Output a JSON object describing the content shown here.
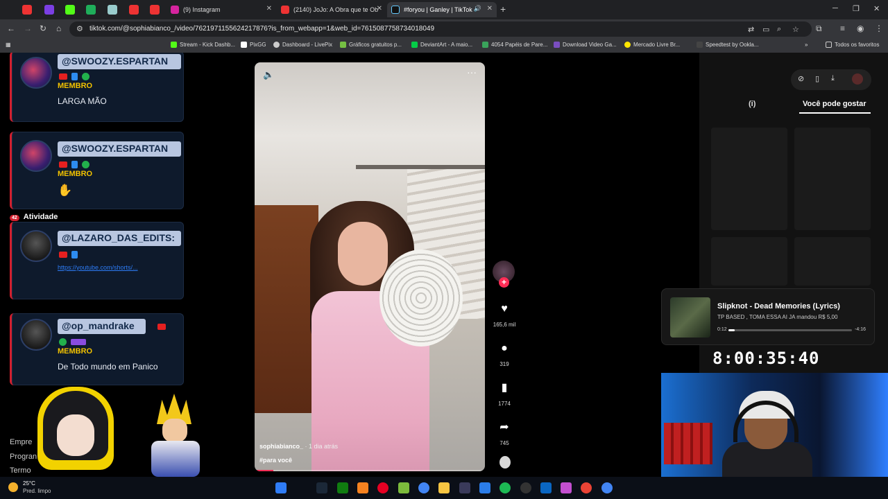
{
  "browser": {
    "tabs": [
      {
        "title": "(9) Instagram",
        "active": false
      },
      {
        "title": "(2140) JoJo: A Obra que te Ob",
        "active": false
      },
      {
        "title": "#foryou | Ganley | TikTok",
        "active": true
      }
    ],
    "new_tab_label": "+",
    "url": "tiktok.com/@sophiabianco_/video/7621971155624217876?is_from_webapp=1&web_id=7615087758734018049",
    "bookmarks": [
      {
        "label": "Stream - Kick Dashb...",
        "color": "#53fc18"
      },
      {
        "label": "PixGG",
        "color": "#ffffff"
      },
      {
        "label": "Dashboard - LivePix",
        "color": "#cccccc"
      },
      {
        "label": "Gráficos gratuitos p...",
        "color": "#76c043"
      },
      {
        "label": "DeviantArt - A maio...",
        "color": "#05cc47"
      },
      {
        "label": "4054 Papéis de Pare...",
        "color": "#3aa35b"
      },
      {
        "label": "Download Video Ga...",
        "color": "#7a4ec0"
      },
      {
        "label": "Mercado Livre Br...",
        "color": "#ffe600"
      },
      {
        "label": "Speedtest by Ookla...",
        "color": "#1e1e1e"
      }
    ],
    "all_bookmarks_label": "Todos os favoritos"
  },
  "chat": {
    "messages": [
      {
        "name": "@SWOOZY.ESPARTAN",
        "role": "MEMBRO",
        "text": "LARGA MÃO"
      },
      {
        "name": "@SWOOZY.ESPARTAN",
        "role": "MEMBRO",
        "text": "✋"
      },
      {
        "name": "@LAZARO_DAS_EDITS:",
        "link": "https://youtube.com/shorts/..."
      },
      {
        "name": "@op_mandrake",
        "role": "MEMBRO",
        "text": "De Todo mundo em Panico"
      }
    ],
    "activity_label": "Atividade",
    "activity_count": "42",
    "left_partial": [
      "Empre",
      "Progran",
      "Termo"
    ]
  },
  "video": {
    "author": "sophiabianco_",
    "time_ago": " · 1 dia atrás",
    "tag": "#para você",
    "progress": 0.08,
    "mute_icon": "🔈",
    "more_icon": "···"
  },
  "actions": {
    "likes": "165,6 mil",
    "comments": "319",
    "saves": "1774",
    "shares": "745",
    "follow_icon": "+"
  },
  "right_panel": {
    "tab_info": "(i)",
    "tab_you_may_like": "Você pode gostar"
  },
  "music": {
    "title": "Slipknot - Dead Memories (Lyrics)",
    "subtitle": "TP BASED , TOMA ESSA AI JA mandou R$ 5,00",
    "elapsed": "0:12",
    "remaining": "-4:16",
    "progress": 0.05
  },
  "timer": "8:00:35:40",
  "taskbar": {
    "temperature": "25°C",
    "weather": "Pred. limpo"
  }
}
